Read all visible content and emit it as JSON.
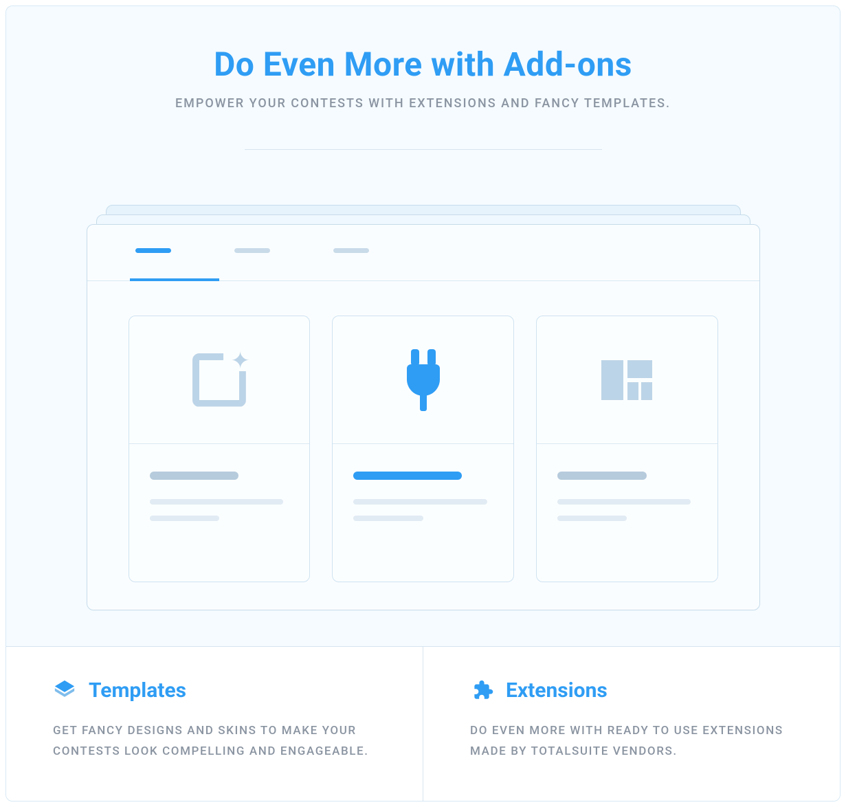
{
  "header": {
    "title": "Do Even More with Add-ons",
    "subtitle": "EMPOWER YOUR CONTESTS WITH EXTENSIONS AND FANCY TEMPLATES."
  },
  "features": [
    {
      "title": "Templates",
      "description": "GET FANCY DESIGNS AND SKINS TO MAKE YOUR CONTESTS LOOK COMPELLING AND ENGAGEABLE."
    },
    {
      "title": "Extensions",
      "description": "DO EVEN MORE WITH READY TO USE EXTENSIONS MADE BY TOTALSUITE VENDORS."
    }
  ]
}
